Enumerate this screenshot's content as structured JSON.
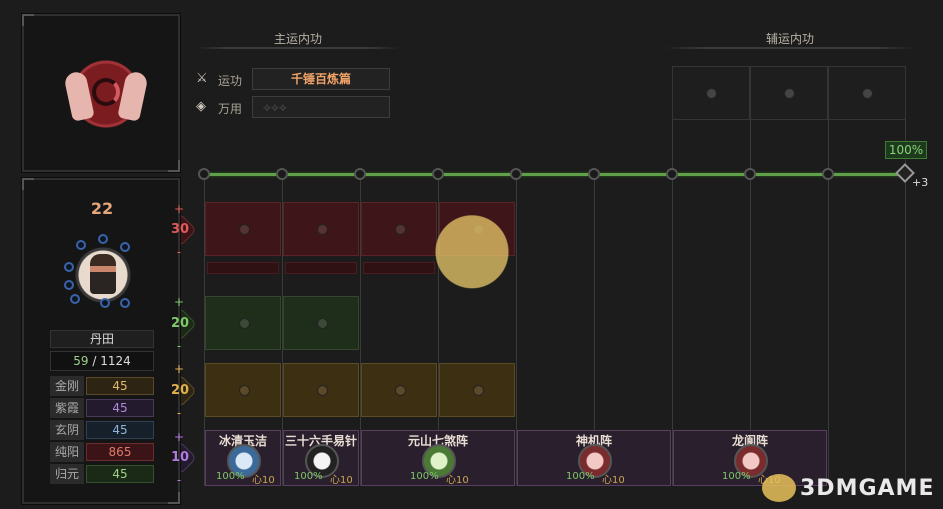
{
  "sections": {
    "main_title": "主运内功",
    "aux_title": "辅运内功"
  },
  "controls": {
    "yungong_label": "运功",
    "yungong_value": "千锤百炼篇",
    "wanyong_label": "万用",
    "wanyong_value": "⟡⟡⟡"
  },
  "character": {
    "level": "22",
    "dantian_label": "丹田",
    "dantian_current": "59",
    "dantian_sep": "/",
    "dantian_max": "1124"
  },
  "stats": [
    {
      "label": "金刚",
      "value": "45",
      "color": "#e3b86a"
    },
    {
      "label": "紫霞",
      "value": "45",
      "color": "#b08ad8"
    },
    {
      "label": "玄阴",
      "value": "45",
      "color": "#8fb5d8"
    },
    {
      "label": "纯阳",
      "value": "865",
      "color": "#e07a6a"
    },
    {
      "label": "归元",
      "value": "45",
      "color": "#9fd08a"
    }
  ],
  "rows": [
    {
      "value": "30",
      "plus": "+",
      "minus": "-",
      "color": "#e05a5a"
    },
    {
      "value": "20",
      "plus": "+",
      "minus": "-",
      "color": "#7fc86b"
    },
    {
      "value": "20",
      "plus": "+",
      "minus": "-",
      "color": "#e0b04a"
    },
    {
      "value": "10",
      "plus": "+",
      "minus": "-",
      "color": "#b07ae0"
    }
  ],
  "progress": {
    "label": "100%",
    "bonus": "+3",
    "fraction": 1.0
  },
  "skills": [
    {
      "name": "冰清玉洁",
      "pct": "100%",
      "cost": "心10"
    },
    {
      "name": "三十六手易针法",
      "pct": "100%",
      "cost": "心10"
    },
    {
      "name": "元山七煞阵",
      "pct": "100%",
      "cost": "心10"
    },
    {
      "name": "神机阵",
      "pct": "100%",
      "cost": "心10"
    },
    {
      "name": "龙阆阵",
      "pct": "100%",
      "cost": "心10"
    }
  ],
  "watermark": "3DMGAME"
}
